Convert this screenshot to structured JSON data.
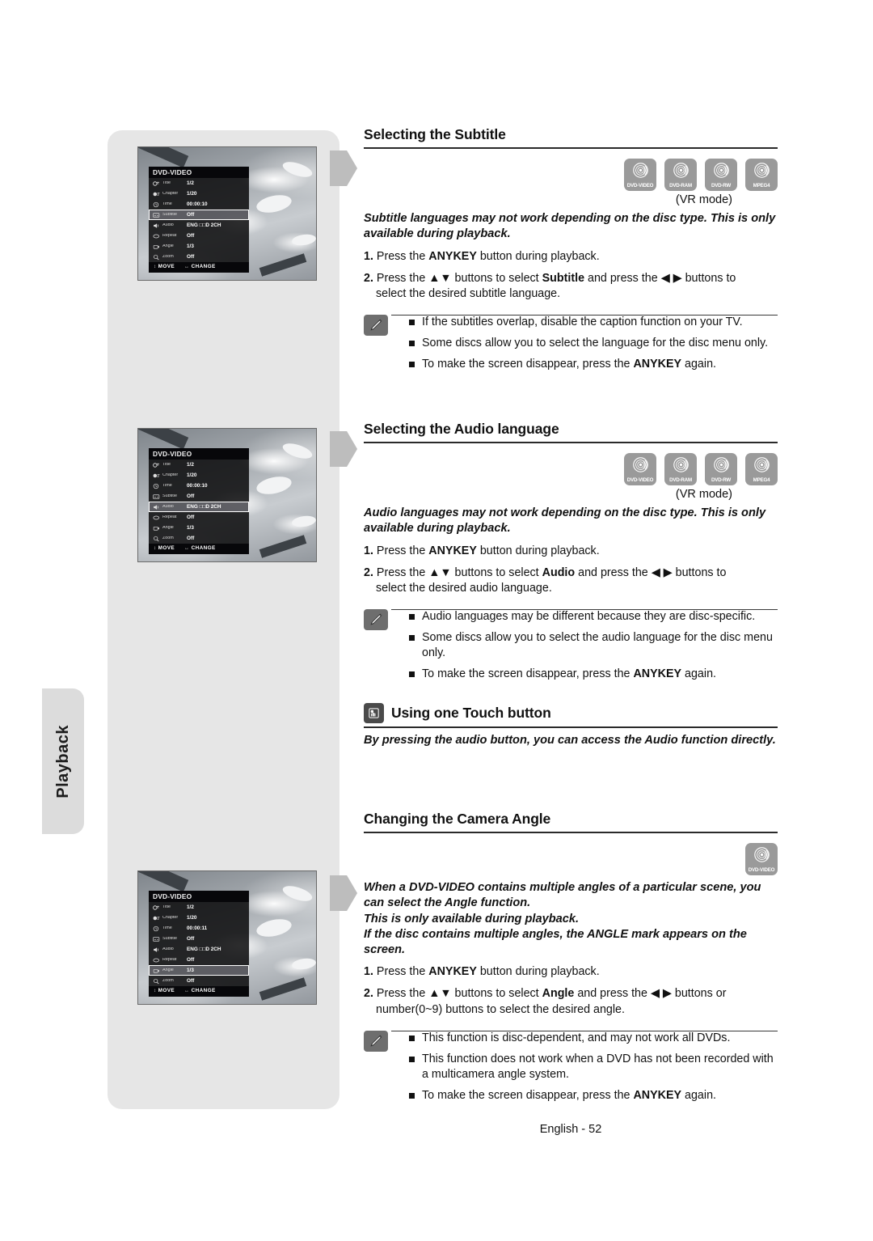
{
  "page": {
    "footer": "English - 52",
    "side_tab": "Playback"
  },
  "sections": [
    {
      "id": "subtitle",
      "title": "Selecting the Subtitle",
      "discs": [
        "DVD-VIDEO",
        "DVD-RAM",
        "DVD-RW",
        "MPEG4"
      ],
      "vr_mode": "(VR mode)",
      "lead": "Subtitle languages may not work depending on the disc type. This is only available during playback.",
      "steps": [
        {
          "num": "1.",
          "text_before": "Press the ",
          "bold1": "ANYKEY",
          "text_mid": " button during playback.",
          "bold2": "",
          "text_after": "",
          "cont": ""
        },
        {
          "num": "2.",
          "text_before": "Press the ▲▼ buttons to select ",
          "bold1": "Subtitle",
          "text_mid": " and press the ◀ ▶ buttons to",
          "bold2": "",
          "text_after": "",
          "cont": "select the desired subtitle language."
        }
      ],
      "notes": [
        {
          "pre": "If the subtitles overlap, disable the caption function on your TV.",
          "bold": "",
          "post": ""
        },
        {
          "pre": "Some discs allow you to select the language for the disc menu only.",
          "bold": "",
          "post": ""
        },
        {
          "pre": "To make the screen disappear, press the ",
          "bold": "ANYKEY",
          "post": " again."
        }
      ]
    },
    {
      "id": "audio",
      "title": "Selecting the Audio language",
      "discs": [
        "DVD-VIDEO",
        "DVD-RAM",
        "DVD-RW",
        "MPEG4"
      ],
      "vr_mode": "(VR mode)",
      "lead": "Audio languages may not work depending on the disc type. This is only available during playback.",
      "steps": [
        {
          "num": "1.",
          "text_before": "Press the ",
          "bold1": "ANYKEY",
          "text_mid": " button during playback.",
          "bold2": "",
          "text_after": "",
          "cont": ""
        },
        {
          "num": "2.",
          "text_before": "Press the ▲▼ buttons to select ",
          "bold1": "Audio",
          "text_mid": " and press the ◀ ▶ buttons to",
          "bold2": "",
          "text_after": "",
          "cont": "select the desired audio language."
        }
      ],
      "notes": [
        {
          "pre": "Audio languages may be different because they are disc-specific.",
          "bold": "",
          "post": ""
        },
        {
          "pre": "Some discs allow you to select the audio language for the disc menu only.",
          "bold": "",
          "post": ""
        },
        {
          "pre": "To make the screen disappear, press the ",
          "bold": "ANYKEY",
          "post": " again."
        }
      ]
    },
    {
      "id": "angle",
      "title": "Changing the Camera Angle",
      "discs": [
        "DVD-VIDEO"
      ],
      "vr_mode": "",
      "lead": "When a DVD-VIDEO contains multiple angles of a particular scene, you can select the Angle function.\nThis is only available during playback.\nIf the disc contains multiple angles, the ANGLE mark appears on the screen.",
      "steps": [
        {
          "num": "1.",
          "text_before": "Press the ",
          "bold1": "ANYKEY",
          "text_mid": " button during playback.",
          "bold2": "",
          "text_after": "",
          "cont": ""
        },
        {
          "num": "2.",
          "text_before": "Press the ▲▼ buttons to select ",
          "bold1": "Angle",
          "text_mid": " and press the ◀ ▶ buttons or",
          "bold2": "",
          "text_after": "",
          "cont": "number(0~9) buttons to select the desired angle."
        }
      ],
      "notes": [
        {
          "pre": "This function is disc-dependent, and may not work all DVDs.",
          "bold": "",
          "post": ""
        },
        {
          "pre": "This function does not work when a DVD has not been recorded with a multicamera angle system.",
          "bold": "",
          "post": ""
        },
        {
          "pre": "To make the screen disappear, press the ",
          "bold": "ANYKEY",
          "post": " again."
        }
      ]
    }
  ],
  "touch_section": {
    "title": "Using one Touch button",
    "lead": "By pressing the audio button, you can access the Audio function directly."
  },
  "osd_screens": [
    {
      "id": "osd-subtitle",
      "header": "DVD-VIDEO",
      "selected": "Subtitle",
      "rows": [
        {
          "icon": "title-icon",
          "label": "Title",
          "value": "1/2"
        },
        {
          "icon": "chapter-icon",
          "label": "Chapter",
          "value": "1/20"
        },
        {
          "icon": "time-icon",
          "label": "Time",
          "value": "00:00:10"
        },
        {
          "icon": "subtitle-icon",
          "label": "Subtitle",
          "value": "Off"
        },
        {
          "icon": "audio-icon",
          "label": "Audio",
          "value": "ENG □□D  2CH"
        },
        {
          "icon": "repeat-icon",
          "label": "Repeat",
          "value": "Off"
        },
        {
          "icon": "angle-icon",
          "label": "Angle",
          "value": "1/3"
        },
        {
          "icon": "zoom-icon",
          "label": "Zoom",
          "value": "Off"
        }
      ],
      "footer_move": "MOVE",
      "footer_change": "CHANGE"
    },
    {
      "id": "osd-audio",
      "header": "DVD-VIDEO",
      "selected": "Audio",
      "rows": [
        {
          "icon": "title-icon",
          "label": "Title",
          "value": "1/2"
        },
        {
          "icon": "chapter-icon",
          "label": "Chapter",
          "value": "1/20"
        },
        {
          "icon": "time-icon",
          "label": "Time",
          "value": "00:00:10"
        },
        {
          "icon": "subtitle-icon",
          "label": "Subtitle",
          "value": "Off"
        },
        {
          "icon": "audio-icon",
          "label": "Audio",
          "value": "ENG □□D  2CH"
        },
        {
          "icon": "repeat-icon",
          "label": "Repeat",
          "value": "Off"
        },
        {
          "icon": "angle-icon",
          "label": "Angle",
          "value": "1/3"
        },
        {
          "icon": "zoom-icon",
          "label": "Zoom",
          "value": "Off"
        }
      ],
      "footer_move": "MOVE",
      "footer_change": "CHANGE"
    },
    {
      "id": "osd-angle",
      "header": "DVD-VIDEO",
      "selected": "Angle",
      "rows": [
        {
          "icon": "title-icon",
          "label": "Title",
          "value": "1/2"
        },
        {
          "icon": "chapter-icon",
          "label": "Chapter",
          "value": "1/20"
        },
        {
          "icon": "time-icon",
          "label": "Time",
          "value": "00:00:11"
        },
        {
          "icon": "subtitle-icon",
          "label": "Subtitle",
          "value": "Off"
        },
        {
          "icon": "audio-icon",
          "label": "Audio",
          "value": "ENG □□D  2CH"
        },
        {
          "icon": "repeat-icon",
          "label": "Repeat",
          "value": "Off"
        },
        {
          "icon": "angle-icon",
          "label": "Angle",
          "value": "1/3"
        },
        {
          "icon": "zoom-icon",
          "label": "Zoom",
          "value": "Off"
        }
      ],
      "footer_move": "MOVE",
      "footer_change": "CHANGE"
    }
  ],
  "colors": {
    "panel_gray": "#e6e6e6",
    "tab_gray": "#dcdcdc",
    "disc_badge": "#9a9a9a",
    "note_icon": "#6e6e6e",
    "pointer": "#bdbdbd"
  }
}
